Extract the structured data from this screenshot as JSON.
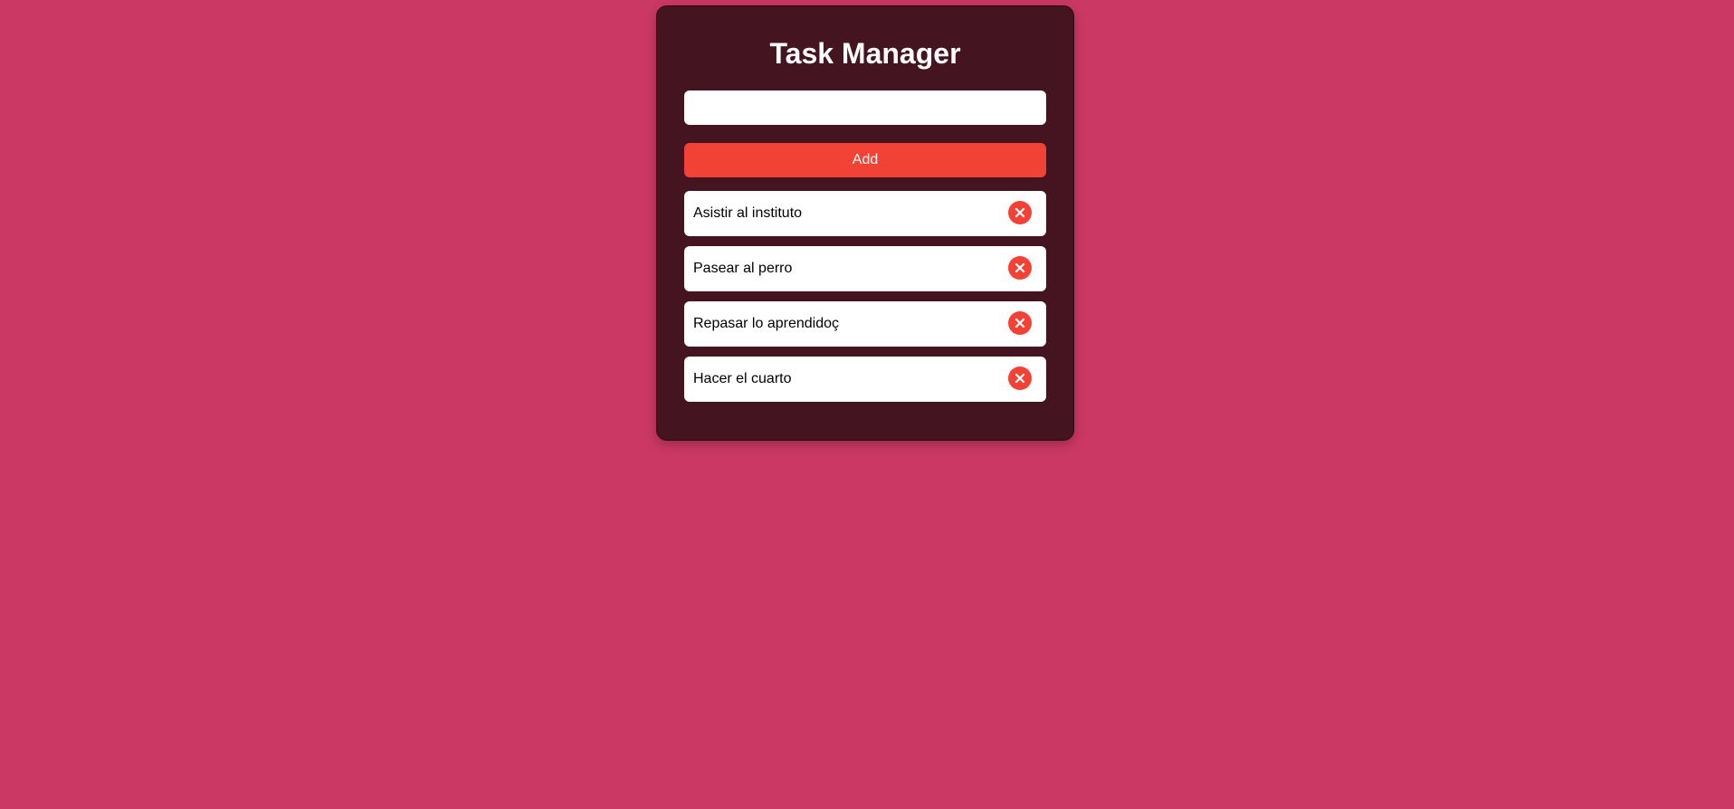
{
  "app": {
    "title": "Task Manager"
  },
  "form": {
    "input_value": "",
    "input_placeholder": "",
    "add_label": "Add"
  },
  "tasks": [
    {
      "text": "Asistir al instituto",
      "delete_icon": "close-icon"
    },
    {
      "text": "Pasear al perro",
      "delete_icon": "close-icon"
    },
    {
      "text": "Repasar lo aprendidoç",
      "delete_icon": "close-icon"
    },
    {
      "text": "Hacer el cuarto",
      "delete_icon": "close-icon"
    }
  ],
  "colors": {
    "page_background": "#cb3864",
    "card_background": "#441420",
    "accent": "#f24236",
    "item_background": "#ffffff"
  }
}
